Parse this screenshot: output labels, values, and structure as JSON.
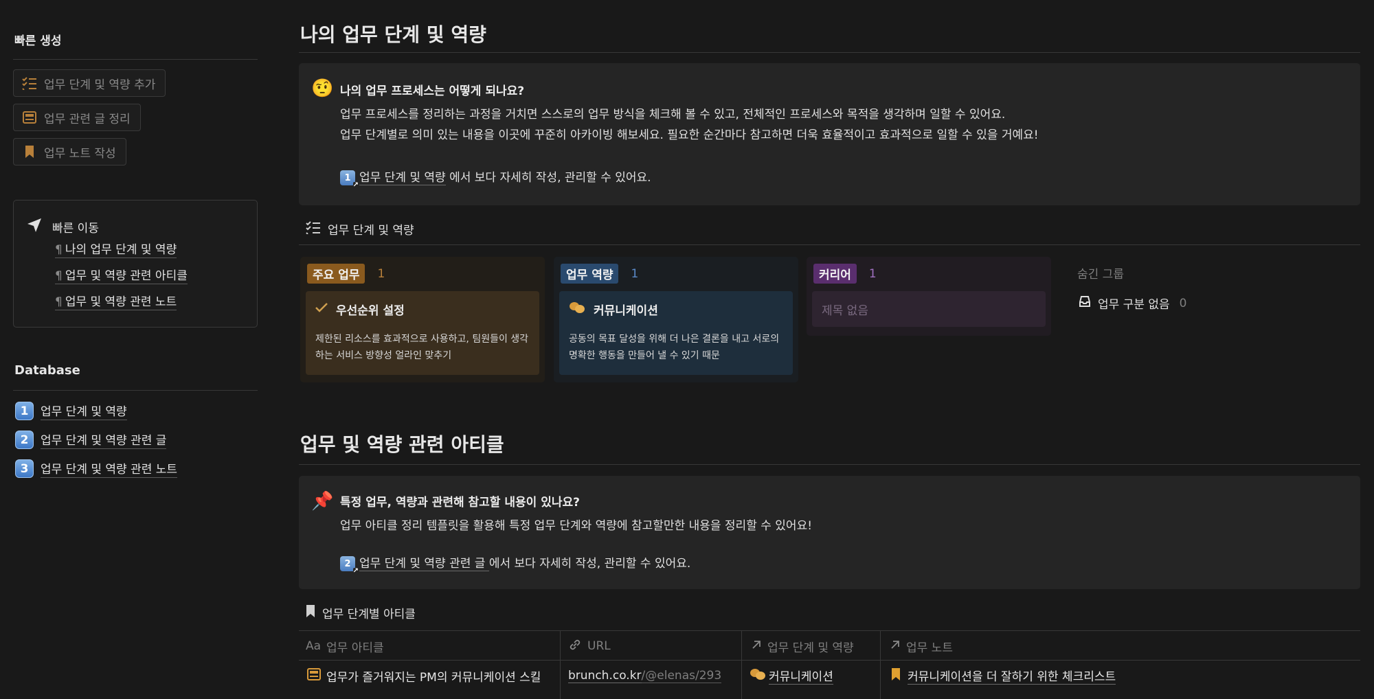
{
  "sidebar": {
    "quick_create_title": "빠른 생성",
    "quick_buttons": [
      {
        "label": "업무 단계 및 역량 추가",
        "icon": "checklist-icon"
      },
      {
        "label": "업무 관련 글 정리",
        "icon": "newspaper-icon"
      },
      {
        "label": "업무 노트 작성",
        "icon": "bookmark-icon"
      }
    ],
    "quick_nav": {
      "title": "빠른 이동",
      "links": [
        "나의 업무 단계 및 역량",
        "업무 및 역량 관련 아티클",
        "업무 및 역량 관련 노트"
      ]
    },
    "database_title": "Database",
    "database_items": [
      {
        "num": "1",
        "label": "업무 단계 및 역량"
      },
      {
        "num": "2",
        "label": "업무 단계 및 역량 관련 글"
      },
      {
        "num": "3",
        "label": "업무 단계 및 역량 관련 노트"
      }
    ]
  },
  "section1": {
    "title": "나의 업무 단계 및 역량",
    "callout": {
      "emoji": "🤨",
      "title": "나의 업무 프로세스는 어떻게 되나요?",
      "line1": "업무 프로세스를 정리하는 과정을 거치면 스스로의 업무 방식을 체크해 볼 수 있고, 전체적인 프로세스와 목적을 생각하며 일할 수 있어요.",
      "line2": "업무 단계별로 의미 있는 내용을 이곳에 꾸준히 아카이빙 해보세요. 필요한 순간마다 참고하면 더욱 효율적이고 효과적으로 일할 수 있을 거예요!",
      "link_num": "1",
      "link_label": "업무 단계 및 역량",
      "link_suffix": " 에서 보다 자세히 작성, 관리할 수 있어요."
    },
    "board_title": "업무 단계 및 역량",
    "columns": [
      {
        "tag": "주요 업무",
        "count": "1",
        "card_title": "우선순위 설정",
        "card_desc": "제한된 리소스를 효과적으로 사용하고, 팀원들이 생각하는 서비스 방향성 얼라인 맞추기"
      },
      {
        "tag": "업무 역량",
        "count": "1",
        "card_title": "커뮤니케이션",
        "card_desc": "공동의 목표 달성을 위해 더 나은 결론을 내고 서로의 명확한 행동을 만들어 낼 수 있기 때문"
      },
      {
        "tag": "커리어",
        "count": "1",
        "card_title": "제목 없음"
      }
    ],
    "hidden_groups": {
      "title": "숨긴 그룹",
      "label": "업무 구분 없음",
      "count": "0"
    }
  },
  "section2": {
    "title": "업무 및 역량 관련 아티클",
    "callout": {
      "emoji": "📌",
      "title": "특정 업무, 역량과 관련해 참고할 내용이 있나요?",
      "line1": "업무 아티클 정리 템플릿을 활용해 특정 업무 단계와 역량에 참고할만한 내용을 정리할 수 있어요!",
      "link_num": "2",
      "link_label": "업무 단계 및 역량 관련 글 ",
      "link_suffix": " 에서 보다 자세히 작성, 관리할 수 있어요."
    },
    "table_title": "업무 단계별 아티클",
    "columns": [
      {
        "icon": "Aa",
        "label": "업무 아티클"
      },
      {
        "icon": "link-icon",
        "label": "URL"
      },
      {
        "icon": "relation-arrow-icon",
        "label": "업무 단계 및 역량"
      },
      {
        "icon": "relation-arrow-icon",
        "label": "업무 노트"
      }
    ],
    "rows": [
      {
        "title": "업무가 즐거워지는 PM의 커뮤니케이션 스킬",
        "url_domain": "brunch.co.kr",
        "url_path": "/@elenas/293",
        "stage": "커뮤니케이션",
        "note": "커뮤니케이션을 더 잘하기 위한 체크리스트"
      }
    ]
  },
  "colors": {
    "background": "#191919",
    "callout": "#252525",
    "tag_main": "#8a5a1e",
    "tag_skill": "#2a4a6e",
    "tag_career": "#5a2e6e"
  }
}
